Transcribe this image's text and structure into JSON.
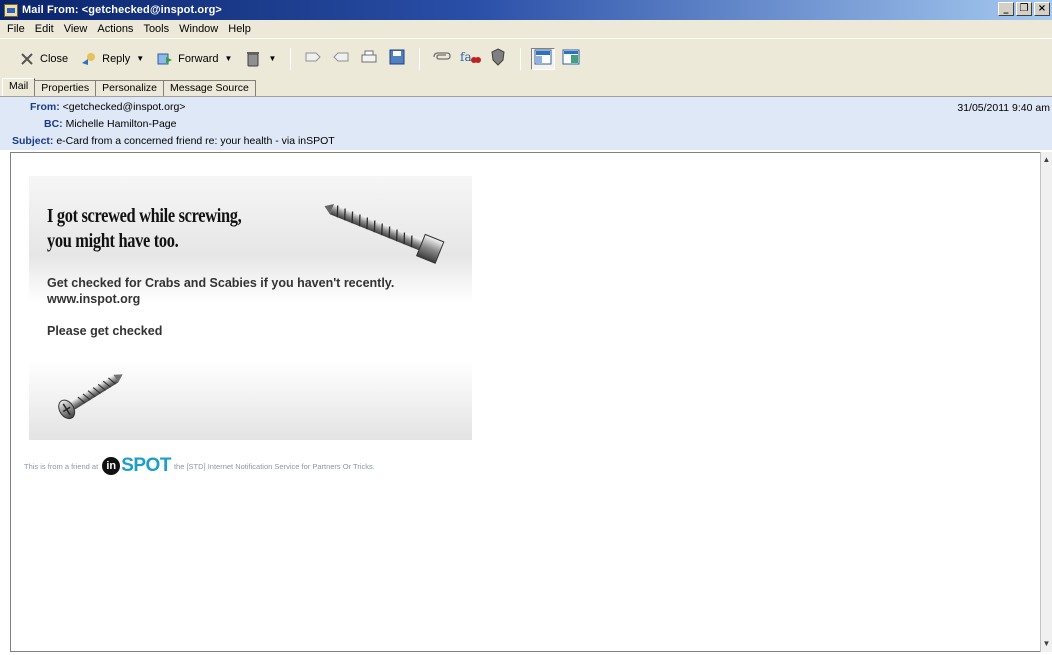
{
  "window": {
    "title": "Mail From: <getchecked@inspot.org>",
    "controls": {
      "minimize": "_",
      "restore": "❐",
      "close": "×"
    }
  },
  "menu": [
    "File",
    "Edit",
    "View",
    "Actions",
    "Tools",
    "Window",
    "Help"
  ],
  "toolbar": {
    "close_label": "Close",
    "reply_label": "Reply",
    "forward_label": "Forward"
  },
  "tabs": [
    "Mail",
    "Properties",
    "Personalize",
    "Message Source"
  ],
  "header": {
    "from_label": "From:",
    "from_value": "<getchecked@inspot.org>",
    "bc_label": "BC:",
    "bc_value": "Michelle Hamilton-Page",
    "subject_label": "Subject:",
    "subject_value": "e-Card from a concerned friend re: your health - via inSPOT",
    "date": "31/05/2011 9:40 am"
  },
  "ecard": {
    "headline_1": "I got screwed while screwing,",
    "headline_2": "you might have too.",
    "line_1": "Get checked for Crabs and Scabies if you haven't recently.",
    "line_2": "www.inspot.org",
    "line_3": "Please get checked"
  },
  "footer": {
    "prefix": "This is from a friend at",
    "logo_in": "in",
    "logo_spot": "SPOT",
    "suffix": "the [STD] Internet Notification Service for Partners Or Tricks."
  },
  "colors": {
    "title_gradient_start": "#0a246a",
    "header_bg": "#dfe8f6",
    "label_blue": "#1a3a8a",
    "logo_blue": "#1aa0c8"
  }
}
